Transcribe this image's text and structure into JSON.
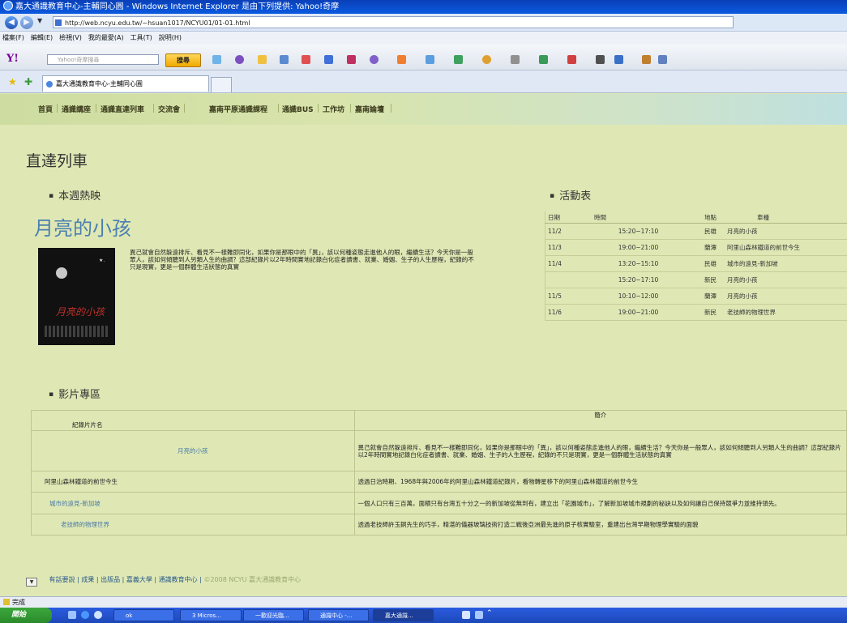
{
  "window": {
    "title": "嘉大通識教育中心-主輔同心圓 - Windows Internet Explorer 是由下列提供: Yahoo!奇摩"
  },
  "address": {
    "url": "http://web.ncyu.edu.tw/~hsuan1017/NCYU01/01-01.html"
  },
  "menu": [
    "檔案(F)",
    "編輯(E)",
    "檢視(V)",
    "我的最愛(A)",
    "工具(T)",
    "說明(H)"
  ],
  "yahoo_toolbar": {
    "logo": "Y!",
    "search_placeholder": "Yahoo!奇摩搜尋",
    "search_button": "搜尋"
  },
  "tab": {
    "title": "嘉大通識教育中心-主輔同心圓"
  },
  "site_nav": [
    "首頁",
    "通識講座",
    "通識直達列車",
    "交流會",
    "嘉南平原通識課程",
    "通識BUS",
    "工作坊",
    "嘉南論壇"
  ],
  "page_title": "直達列車",
  "this_week": {
    "heading": "本週熱映",
    "movie_title": "月亮的小孩",
    "description": "異己就會自然躲遠排斥、看見不一樣難即同化，如果你是那眼中的「異」，該以何種姿態走進他人的眼，繼續生活？今天你是一般眾人，該如何傾聽到人另類人生的曲調？這部紀錄片以2年時間實地記錄白化症者讀書、就業、婚姻、生子的人生歷程，紀錄的不只是現實，更是一個群體生活狀態的真實"
  },
  "schedule": {
    "heading": "活動表",
    "columns": [
      "日期",
      "時間",
      "地點",
      "車種"
    ],
    "rows": [
      {
        "date": "11/2",
        "time": "15:20~17:10",
        "place": "民雄",
        "film": "月亮的小孩"
      },
      {
        "date": "11/3",
        "time": "19:00~21:00",
        "place": "蘭潭",
        "film": "阿里山森林鐵道的前世今生"
      },
      {
        "date": "11/4",
        "time": "13:20~15:10",
        "place": "民雄",
        "film": "城市的遠見-新加坡"
      },
      {
        "date": "",
        "time": "15:20~17:10",
        "place": "新民",
        "film": "月亮的小孩"
      },
      {
        "date": "11/5",
        "time": "10:10~12:00",
        "place": "蘭潭",
        "film": "月亮的小孩"
      },
      {
        "date": "11/6",
        "time": "19:00~21:00",
        "place": "新民",
        "film": "老技師的物理世界"
      }
    ]
  },
  "films": {
    "heading": "影片專區",
    "columns": [
      "紀錄片片名",
      "簡介"
    ],
    "rows": [
      {
        "name": "月亮的小孩",
        "desc": "異己就會自然躲遠排斥、看見不一樣難即同化，如果你是那眼中的「異」，該以何種姿態走進他人的眼，繼續生活？今天你是一般眾人，該如何傾聽到人另類人生的曲調？這部紀錄片以2年時間實地記錄白化症者讀書、就業、婚姻、生子的人生歷程，紀錄的不只是現實，更是一個群體生活狀態的真實"
      },
      {
        "name": "阿里山森林鐵道的前世今生",
        "desc": "透過日治時期、1968年與2006年的阿里山森林鐵道紀錄片，看物轉星移下的阿里山森林鐵道的前世今生"
      },
      {
        "name": "城市的遠見-新加坡",
        "desc": "一個人口只有三百萬，面積只有台灣五十分之一的新加坡從無到有，建立出「花園城市」，了解新加坡城市規劃的秘訣以及如何讓自己保持競爭力並維持領先。"
      },
      {
        "name": "老技師的物理世界",
        "desc": "透過老技師許玉銅先生的巧手，精湛的儀器玻璃技術打造二戰後亞洲最先進的原子核實驗室，重建出台灣早期物理學實驗的面貌"
      }
    ]
  },
  "footer": {
    "links": [
      "有話要說",
      "成果",
      "出版品",
      "嘉義大學",
      "通識教育中心"
    ],
    "copyright": "©2008 NCYU 嘉大通識教育中心"
  },
  "status": {
    "text": "完成"
  },
  "taskbar": {
    "start": "開始",
    "items": [
      "ok",
      "3 Micros...",
      "一歡迎光臨...",
      "通識中心 -...",
      "嘉大通識..."
    ]
  }
}
